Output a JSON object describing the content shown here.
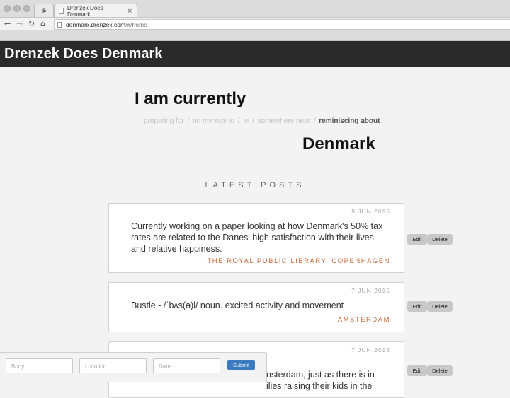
{
  "browser": {
    "tab_title": "Drenzek Does Denmark",
    "url_host": "denmark.drenzek.com",
    "url_path": "/#/home"
  },
  "site": {
    "title": "Drenzek Does Denmark"
  },
  "hero": {
    "heading": "I am currently",
    "status_options": [
      "preparing for",
      "on my way to",
      "in",
      "somewhere near",
      "reminiscing about"
    ],
    "active_status": "reminiscing about",
    "separator": "/",
    "country": "Denmark"
  },
  "posts_heading": "LATEST POSTS",
  "posts": [
    {
      "date": "9 JUN 2015",
      "body": "Currently working on a paper looking at how Denmark's 50% tax rates are related to the Danes' high satisfaction with their lives and relative happiness.",
      "location": "THE ROYAL PUBLIC LIBRARY, COPENHAGEN"
    },
    {
      "date": "7 JUN 2015",
      "body": "Bustle - /ˈbʌs(ə)l/ noun. excited activity and movement",
      "location": "AMSTERDAM"
    },
    {
      "date": "7 JUN 2015",
      "body_visible_fragment_1": "nsterdam, just as there is in",
      "body_visible_fragment_2": "ilies raising their kids in the",
      "location": ""
    }
  ],
  "actions": {
    "edit_label": "Edit",
    "delete_label": "Delete"
  },
  "form": {
    "body_placeholder": "Body",
    "location_placeholder": "Location",
    "date_placeholder": "Date",
    "submit_label": "Submit"
  }
}
